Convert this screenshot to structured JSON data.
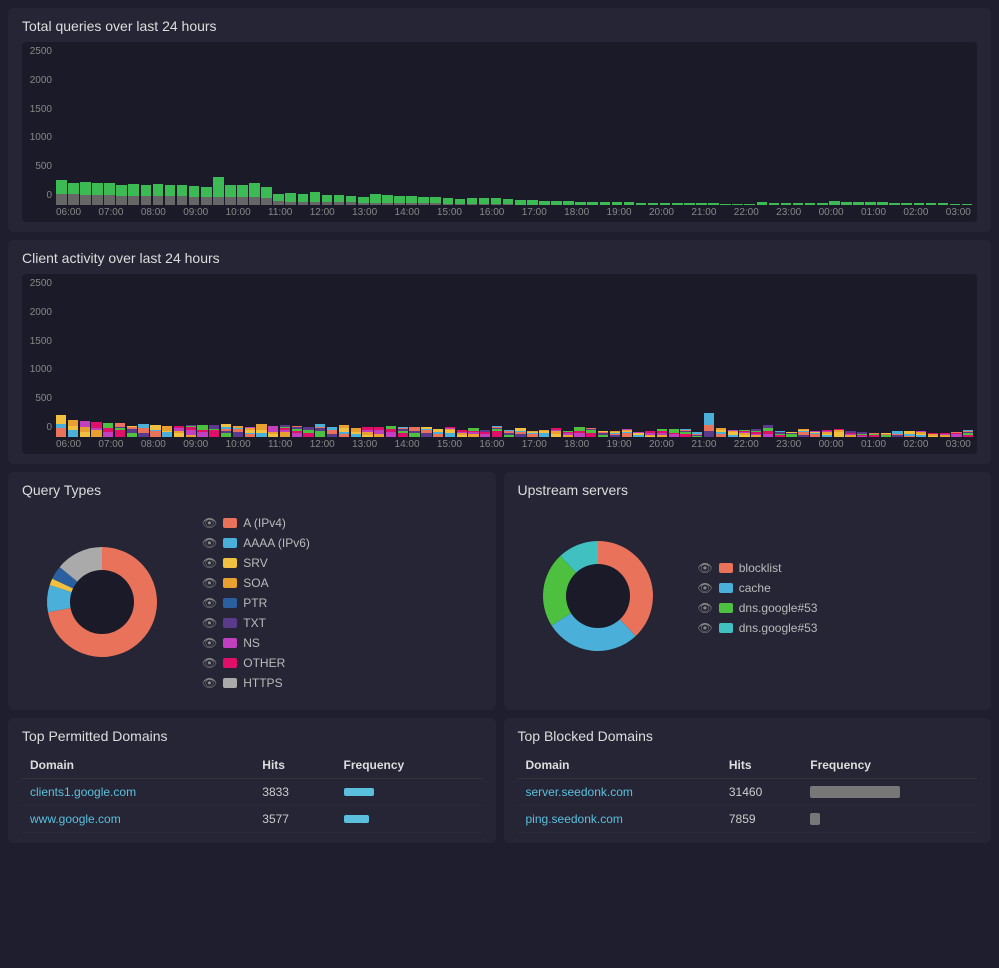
{
  "totalQueries": {
    "title": "Total queries over last 24 hours",
    "yLabels": [
      "2500",
      "2000",
      "1500",
      "1000",
      "500",
      "0"
    ],
    "xLabels": [
      "06:00",
      "07:00",
      "08:00",
      "09:00",
      "10:00",
      "11:00",
      "12:00",
      "13:00",
      "14:00",
      "15:00",
      "16:00",
      "17:00",
      "18:00",
      "19:00",
      "20:00",
      "21:00",
      "22:00",
      "23:00",
      "00:00",
      "01:00",
      "02:00",
      "03:00"
    ],
    "bars": [
      {
        "gray": 180,
        "green": 220
      },
      {
        "gray": 170,
        "green": 180
      },
      {
        "gray": 165,
        "green": 210
      },
      {
        "gray": 160,
        "green": 200
      },
      {
        "gray": 155,
        "green": 190
      },
      {
        "gray": 150,
        "green": 185
      },
      {
        "gray": 148,
        "green": 195
      },
      {
        "gray": 145,
        "green": 185
      },
      {
        "gray": 143,
        "green": 200
      },
      {
        "gray": 140,
        "green": 180
      },
      {
        "gray": 138,
        "green": 175
      },
      {
        "gray": 135,
        "green": 170
      },
      {
        "gray": 133,
        "green": 165
      },
      {
        "gray": 130,
        "green": 320
      },
      {
        "gray": 128,
        "green": 200
      },
      {
        "gray": 125,
        "green": 190
      },
      {
        "gray": 122,
        "green": 230
      },
      {
        "gray": 120,
        "green": 180
      },
      {
        "gray": 60,
        "green": 120
      },
      {
        "gray": 55,
        "green": 140
      },
      {
        "gray": 52,
        "green": 130
      },
      {
        "gray": 50,
        "green": 160
      },
      {
        "gray": 48,
        "green": 115
      },
      {
        "gray": 45,
        "green": 105
      },
      {
        "gray": 42,
        "green": 100
      },
      {
        "gray": 40,
        "green": 95
      },
      {
        "gray": 38,
        "green": 140
      },
      {
        "gray": 35,
        "green": 130
      },
      {
        "gray": 33,
        "green": 120
      },
      {
        "gray": 30,
        "green": 110
      },
      {
        "gray": 28,
        "green": 100
      },
      {
        "gray": 25,
        "green": 95
      },
      {
        "gray": 22,
        "green": 90
      },
      {
        "gray": 20,
        "green": 85
      },
      {
        "gray": 18,
        "green": 100
      },
      {
        "gray": 15,
        "green": 95
      },
      {
        "gray": 12,
        "green": 90
      },
      {
        "gray": 10,
        "green": 85
      },
      {
        "gray": 8,
        "green": 80
      },
      {
        "gray": 6,
        "green": 75
      },
      {
        "gray": 5,
        "green": 70
      },
      {
        "gray": 4,
        "green": 65
      },
      {
        "gray": 3,
        "green": 60
      },
      {
        "gray": 2,
        "green": 55
      }
    ]
  },
  "clientActivity": {
    "title": "Client activity over last 24 hours",
    "yLabels": [
      "2500",
      "2000",
      "1500",
      "1000",
      "500",
      "0"
    ],
    "xLabels": [
      "06:00",
      "07:00",
      "08:00",
      "09:00",
      "10:00",
      "11:00",
      "12:00",
      "13:00",
      "14:00",
      "15:00",
      "16:00",
      "17:00",
      "18:00",
      "19:00",
      "20:00",
      "21:00",
      "22:00",
      "23:00",
      "00:00",
      "01:00",
      "02:00",
      "03:00"
    ]
  },
  "queryTypes": {
    "title": "Query Types",
    "legend": [
      {
        "label": "A (IPv4)",
        "color": "#e8735a"
      },
      {
        "label": "AAAA (IPv6)",
        "color": "#4ab0d9"
      },
      {
        "label": "SRV",
        "color": "#f0c040"
      },
      {
        "label": "SOA",
        "color": "#e8a030"
      },
      {
        "label": "PTR",
        "color": "#2a5fa0"
      },
      {
        "label": "TXT",
        "color": "#5a3a8a"
      },
      {
        "label": "NS",
        "color": "#c040c0"
      },
      {
        "label": "OTHER",
        "color": "#e0106a"
      },
      {
        "label": "HTTPS",
        "color": "#aaaaaa"
      }
    ],
    "donut": {
      "segments": [
        {
          "color": "#e8735a",
          "pct": 72
        },
        {
          "color": "#4ab0d9",
          "pct": 8
        },
        {
          "color": "#f0c040",
          "pct": 2
        },
        {
          "color": "#2a5fa0",
          "pct": 4
        },
        {
          "color": "#aaaaaa",
          "pct": 14
        }
      ]
    }
  },
  "upstreamServers": {
    "title": "Upstream servers",
    "legend": [
      {
        "label": "blocklist",
        "color": "#e8735a"
      },
      {
        "label": "cache",
        "color": "#4ab0d9"
      },
      {
        "label": "dns.google#53",
        "color": "#4ec040"
      },
      {
        "label": "dns.google#53",
        "color": "#40c0c0"
      }
    ],
    "donut": {
      "segments": [
        {
          "color": "#e8735a",
          "pct": 38
        },
        {
          "color": "#4ab0d9",
          "pct": 28
        },
        {
          "color": "#4ec040",
          "pct": 22
        },
        {
          "color": "#40c0c0",
          "pct": 12
        }
      ]
    }
  },
  "topPermitted": {
    "title": "Top Permitted Domains",
    "headers": [
      "Domain",
      "Hits",
      "Frequency"
    ],
    "rows": [
      {
        "domain": "clients1.google.com",
        "hits": "3833",
        "freqWidth": 30
      },
      {
        "domain": "www.google.com",
        "hits": "3577",
        "freqWidth": 25
      }
    ]
  },
  "topBlocked": {
    "title": "Top Blocked Domains",
    "headers": [
      "Domain",
      "Hits",
      "Frequency"
    ],
    "rows": [
      {
        "domain": "server.seedonk.com",
        "hits": "31460",
        "freqWidth": 90
      },
      {
        "domain": "ping.seedonk.com",
        "hits": "7859",
        "freqWidth": 10
      }
    ]
  }
}
